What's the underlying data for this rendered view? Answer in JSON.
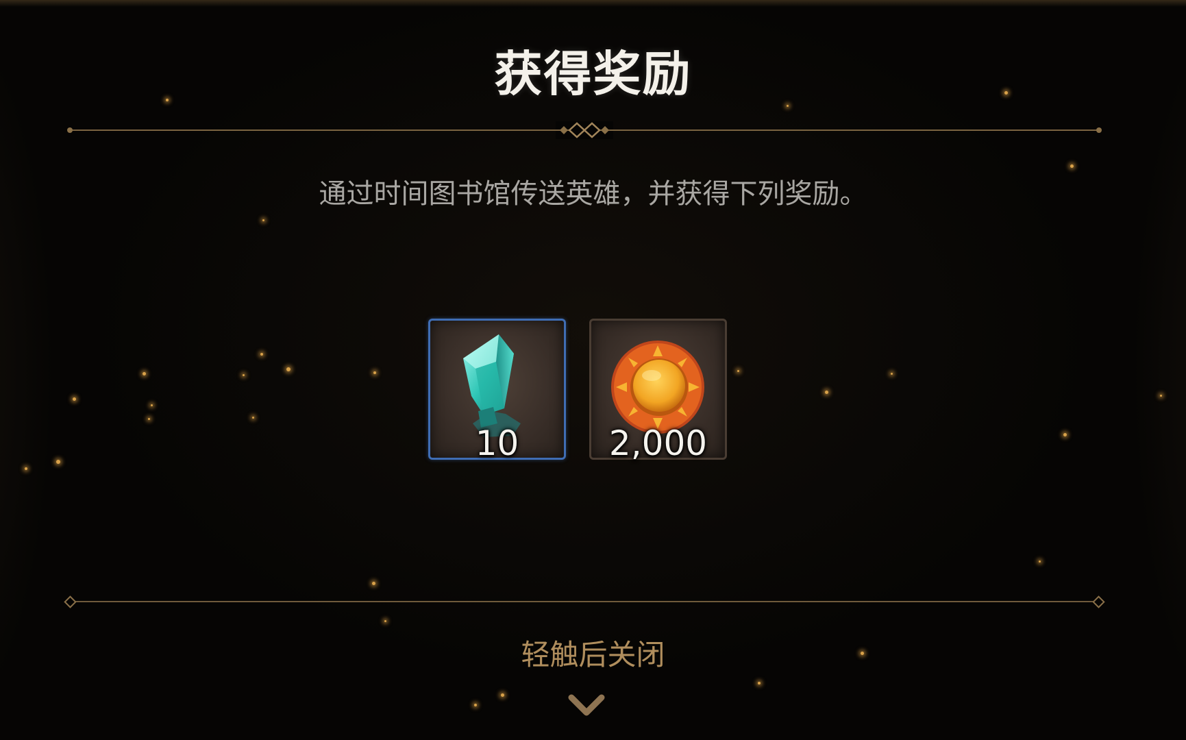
{
  "dialog": {
    "title": "获得奖励",
    "description": "通过时间图书馆传送英雄，并获得下列奖励。",
    "rewards": [
      {
        "icon": "teal-crystal-icon",
        "quantity": "10",
        "frame_color": "#3f6db4"
      },
      {
        "icon": "gold-sun-coin-icon",
        "quantity": "2,000",
        "frame_color": "#4a3d33"
      }
    ],
    "close_hint": "轻触后关闭",
    "close_icon": "chevron-down-icon"
  },
  "colors": {
    "background": "#060504",
    "accent_gold": "#b08e5d",
    "divider": "#7b6441",
    "title_text": "#f4f1ea"
  }
}
